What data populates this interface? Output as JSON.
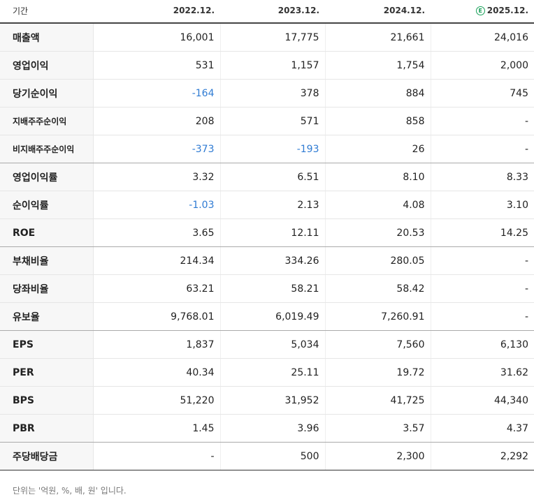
{
  "header": {
    "label": "기간",
    "periods": [
      "2022.12.",
      "2023.12.",
      "2024.12.",
      "2025.12."
    ],
    "estimate_badge": "E"
  },
  "rows": [
    {
      "label": "매출액",
      "values": [
        "16,001",
        "17,775",
        "21,661",
        "24,016"
      ]
    },
    {
      "label": "영업이익",
      "values": [
        "531",
        "1,157",
        "1,754",
        "2,000"
      ]
    },
    {
      "label": "당기순이익",
      "values": [
        "-164",
        "378",
        "884",
        "745"
      ]
    },
    {
      "label": "지배주주순이익",
      "values": [
        "208",
        "571",
        "858",
        "-"
      ]
    },
    {
      "label": "비지배주주순이익",
      "values": [
        "-373",
        "-193",
        "26",
        "-"
      ]
    },
    {
      "label": "영업이익률",
      "values": [
        "3.32",
        "6.51",
        "8.10",
        "8.33"
      ]
    },
    {
      "label": "순이익률",
      "values": [
        "-1.03",
        "2.13",
        "4.08",
        "3.10"
      ]
    },
    {
      "label": "ROE",
      "values": [
        "3.65",
        "12.11",
        "20.53",
        "14.25"
      ]
    },
    {
      "label": "부채비율",
      "values": [
        "214.34",
        "334.26",
        "280.05",
        "-"
      ]
    },
    {
      "label": "당좌비율",
      "values": [
        "63.21",
        "58.21",
        "58.42",
        "-"
      ]
    },
    {
      "label": "유보율",
      "values": [
        "9,768.01",
        "6,019.49",
        "7,260.91",
        "-"
      ]
    },
    {
      "label": "EPS",
      "values": [
        "1,837",
        "5,034",
        "7,560",
        "6,130"
      ]
    },
    {
      "label": "PER",
      "values": [
        "40.34",
        "25.11",
        "19.72",
        "31.62"
      ]
    },
    {
      "label": "BPS",
      "values": [
        "51,220",
        "31,952",
        "41,725",
        "44,340"
      ]
    },
    {
      "label": "PBR",
      "values": [
        "1.45",
        "3.96",
        "3.57",
        "4.37"
      ]
    },
    {
      "label": "주당배당금",
      "values": [
        "-",
        "500",
        "2,300",
        "2,292"
      ]
    }
  ],
  "note": "단위는 '억원, %, 배, 원' 입니다.",
  "colors": {
    "negative": "#2f7bd3",
    "estimate": "#1aa05a"
  }
}
